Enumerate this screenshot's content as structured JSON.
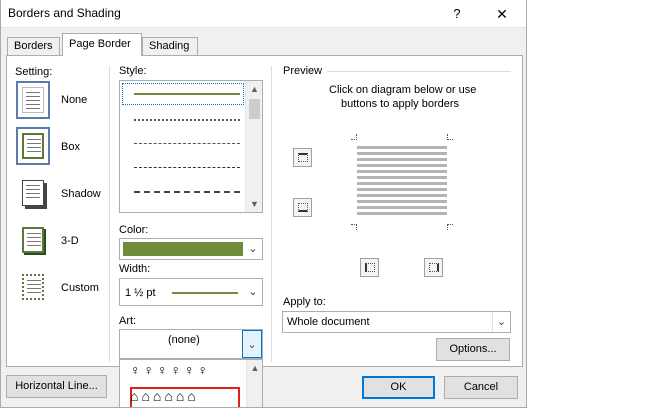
{
  "window": {
    "title": "Borders and Shading",
    "help": "?",
    "close": "✕"
  },
  "tabs": [
    "Borders",
    "Page Border",
    "Shading"
  ],
  "setting": {
    "label": "Setting:",
    "options": [
      "None",
      "Box",
      "Shadow",
      "3-D",
      "Custom"
    ]
  },
  "style": {
    "label": "Style:"
  },
  "color": {
    "label": "Color:",
    "value_hex": "#6f8c3a"
  },
  "width": {
    "label": "Width:",
    "value": "1 ½ pt"
  },
  "art": {
    "label": "Art:",
    "value": "(none)",
    "row1": "♀♀♀♀♀♀",
    "row2": "⌂⌂⌂⌂⌂⌂"
  },
  "preview": {
    "label": "Preview",
    "hint_line1": "Click on diagram below or use",
    "hint_line2": "buttons to apply borders"
  },
  "apply_to": {
    "label": "Apply to:",
    "value": "Whole document"
  },
  "buttons": {
    "options": "Options...",
    "horizontal_line": "Horizontal Line...",
    "ok": "OK",
    "cancel": "Cancel"
  },
  "colors": {
    "accent": "#0078d7",
    "line_green": "#6f8c3a",
    "art_selection": "#e02020"
  }
}
